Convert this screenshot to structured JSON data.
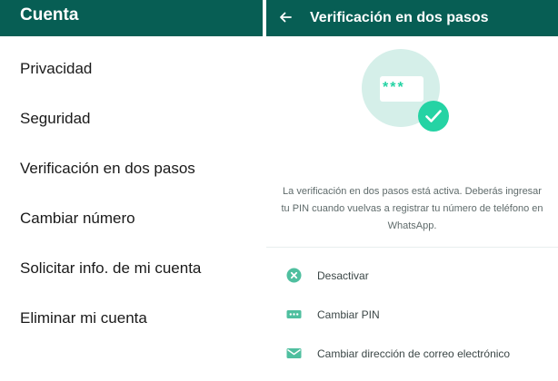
{
  "left": {
    "title": "Cuenta",
    "items": [
      {
        "label": "Privacidad"
      },
      {
        "label": "Seguridad"
      },
      {
        "label": "Verificación en dos pasos"
      },
      {
        "label": "Cambiar número"
      },
      {
        "label": "Solicitar info. de mi cuenta"
      },
      {
        "label": "Eliminar mi cuenta"
      }
    ]
  },
  "right": {
    "back_icon": "arrow-left-icon",
    "title": "Verificación en dos pasos",
    "illustration": {
      "stars": "***"
    },
    "description": "La verificación en dos pasos está activa. Deberás ingresar tu PIN cuando vuelvas a registrar tu número de teléfono en WhatsApp.",
    "options": [
      {
        "label": "Desactivar",
        "icon": "close-circle-icon"
      },
      {
        "label": "Cambiar PIN",
        "icon": "pin-dots-icon"
      },
      {
        "label": "Cambiar dirección de correo electrónico",
        "icon": "envelope-icon"
      }
    ]
  },
  "colors": {
    "header": "#075e54",
    "accent": "#25d3a4",
    "illustration_bg": "#d5efe9"
  }
}
